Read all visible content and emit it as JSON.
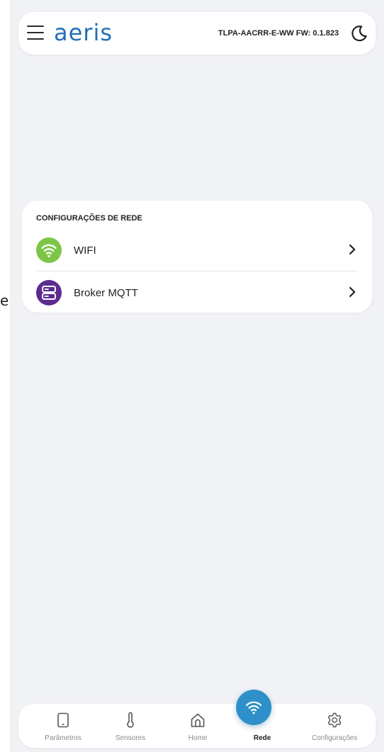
{
  "stray_char": "e",
  "header": {
    "logo_text": "aeris",
    "device_info": "TLPA-AACRR-E-WW FW: 0.1.823",
    "menu_icon": "hamburger-icon",
    "theme_icon": "moon-icon"
  },
  "network_card": {
    "title": "CONFIGURAÇÕES DE REDE",
    "items": [
      {
        "label": "WIFI",
        "icon": "wifi-icon",
        "color": "#7cc546"
      },
      {
        "label": "Broker MQTT",
        "icon": "server-icon",
        "color": "#5c2b8f"
      }
    ]
  },
  "bottom_nav": {
    "items": [
      {
        "label": "Parâmetros",
        "icon": "tablet-icon"
      },
      {
        "label": "Sensores",
        "icon": "thermometer-icon"
      },
      {
        "label": "Home",
        "icon": "home-icon"
      },
      {
        "label": "Rede",
        "icon": "wifi-icon",
        "active": true
      },
      {
        "label": "Configurações",
        "icon": "gear-icon"
      }
    ],
    "active_color": "#2e90c8"
  }
}
